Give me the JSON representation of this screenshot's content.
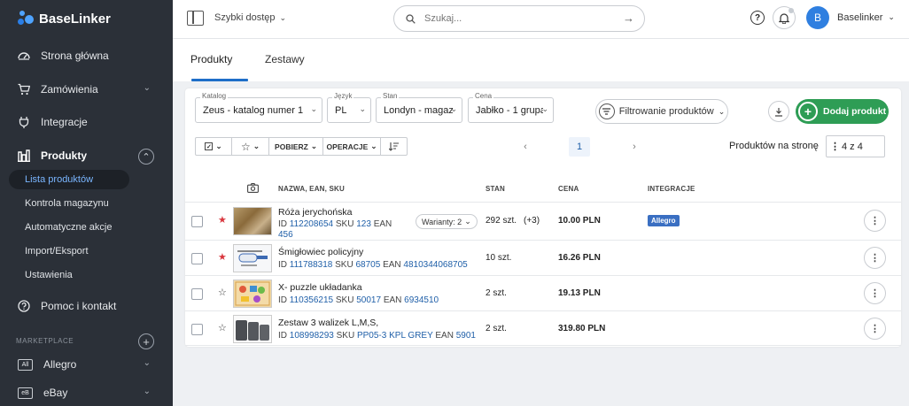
{
  "sidebar": {
    "logo": "BaseLinker",
    "nav": [
      {
        "label": "Strona główna",
        "icon": "dashboard-icon"
      },
      {
        "label": "Zamówienia",
        "icon": "cart-icon"
      },
      {
        "label": "Integracje",
        "icon": "plug-icon"
      },
      {
        "label": "Produkty",
        "icon": "products-icon"
      }
    ],
    "products_sub": [
      "Lista produktów",
      "Kontrola magazynu",
      "Automatyczne akcje",
      "Import/Eksport",
      "Ustawienia"
    ],
    "help": "Pomoc i kontakt",
    "marketplace_label": "MARKETPLACE",
    "marketplaces": [
      {
        "badge": "All",
        "label": "Allegro"
      },
      {
        "badge": "eB",
        "label": "eBay"
      }
    ]
  },
  "topbar": {
    "quick_access": "Szybki dostęp",
    "search_placeholder": "Szukaj...",
    "user_initial": "B",
    "user_name": "Baselinker"
  },
  "tabs": [
    "Produkty",
    "Zestawy"
  ],
  "filters": {
    "catalog": {
      "label": "Katalog",
      "value": "Zeus - katalog numer 1"
    },
    "language": {
      "label": "Język",
      "value": "PL"
    },
    "stock": {
      "label": "Stan",
      "value": "Londyn - magaz"
    },
    "price": {
      "label": "Cena",
      "value": "Jabłko - 1 grupa"
    },
    "filter_button": "Filtrowanie produktów",
    "add_button": "Dodaj produkt"
  },
  "toolbar": {
    "download": "POBIERZ",
    "operations": "OPERACJE"
  },
  "pagination": {
    "current_page": "1",
    "per_page_label": "Produktów na stronę",
    "per_page_value": "4 z 4"
  },
  "columns": {
    "name": "NAZWA, EAN, SKU",
    "stock": "STAN",
    "price": "CENA",
    "integrations": "INTEGRACJE"
  },
  "products": [
    {
      "name": "Róża jerychońska",
      "id": "112208654",
      "sku": "123",
      "ean": "456",
      "variants": "Warianty: 2",
      "stock": "292 szt.",
      "stock_extra": "(+3)",
      "price": "10.00 PLN",
      "integration": "Allegro",
      "favorite": true
    },
    {
      "name": "Śmigłowiec policyjny",
      "id": "111788318",
      "sku": "68705",
      "ean": "4810344068705",
      "stock": "10 szt.",
      "price": "16.26 PLN",
      "favorite": true
    },
    {
      "name": "X- puzzle układanka",
      "id": "110356215",
      "sku": "50017",
      "ean": "6934510",
      "stock": "2 szt.",
      "price": "19.13 PLN",
      "favorite": false
    },
    {
      "name": "Zestaw 3 walizek L,M,S,",
      "id": "108998293",
      "sku": "PP05-3 KPL GREY",
      "ean": "5901",
      "stock": "2 szt.",
      "price": "319.80 PLN",
      "favorite": false
    }
  ],
  "labels": {
    "id": "ID",
    "sku": "SKU",
    "ean": "EAN"
  },
  "colors": {
    "accent": "#1e6ec8",
    "add_button": "#2e9d55",
    "favorite_star": "#d9363e",
    "sidebar": "#2b3038"
  }
}
